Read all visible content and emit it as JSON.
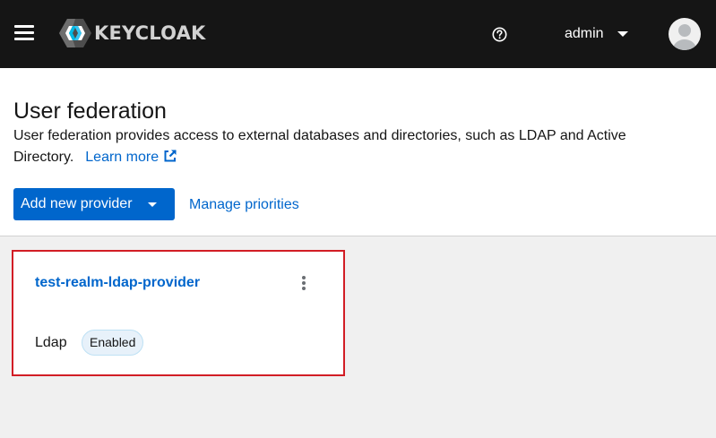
{
  "masthead": {
    "brand": "KEYCLOAK",
    "user_name": "admin",
    "icons": {
      "menu": "hamburger-menu-icon",
      "help": "help-icon",
      "user_dropdown": "caret-down-icon",
      "avatar": "avatar-icon"
    }
  },
  "page": {
    "title": "User federation",
    "description": "User federation provides access to external databases and directories, such as LDAP and Active Directory.",
    "learn_more": "Learn more",
    "add_provider": "Add new provider",
    "manage_priorities": "Manage priorities"
  },
  "providers": [
    {
      "name": "test-realm-ldap-provider",
      "type": "Ldap",
      "status": "Enabled"
    }
  ],
  "colors": {
    "masthead_bg": "#151515",
    "primary": "#0066cc",
    "highlight_outline": "#d21d25",
    "badge_bg": "#e7f1fa"
  }
}
